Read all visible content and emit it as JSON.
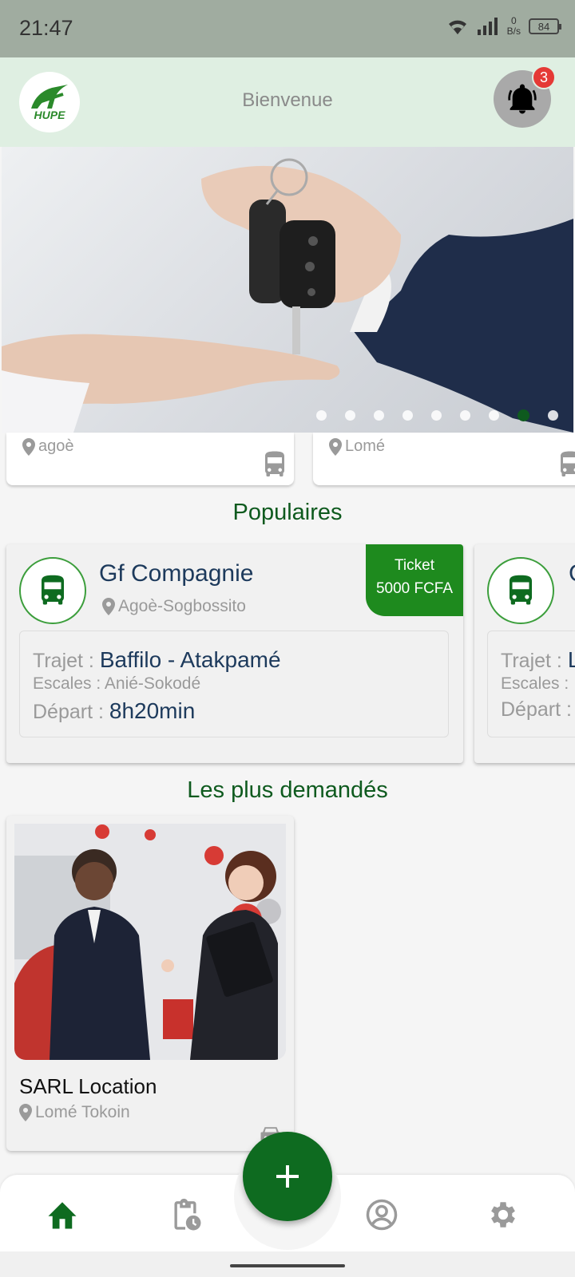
{
  "status_bar": {
    "time": "21:47",
    "net_speed_value": "0",
    "net_speed_unit": "B/s",
    "battery": "84"
  },
  "header": {
    "logo_text": "HUPE",
    "title": "Bienvenue",
    "notification_count": "3"
  },
  "banner": {
    "slide_count": 9,
    "active_slide_index": 7
  },
  "places": [
    {
      "location": "agoè"
    },
    {
      "location": "Lomé"
    }
  ],
  "populaires": {
    "title": "Populaires",
    "cards": [
      {
        "company": "Gf Compagnie",
        "address": "Agoè-Sogbossito",
        "ticket_label": "Ticket",
        "ticket_price": "5000 FCFA",
        "trajet_label": "Trajet : ",
        "trajet_value": "Baffilo - Atakpamé",
        "escales_label": "Escales : ",
        "escales_value": "Anié-Sokodé",
        "depart_label": "Départ : ",
        "depart_value": "8h20min"
      },
      {
        "company": "C",
        "trajet_label": "Trajet : ",
        "trajet_value": "L",
        "escales_label": "Escales : ",
        "depart_label": "Départ : "
      }
    ]
  },
  "demandes": {
    "title": "Les plus demandés",
    "items": [
      {
        "name": "SARL Location",
        "location": "Lomé Tokoin"
      }
    ]
  },
  "colors": {
    "primary_green": "#0e6b20",
    "ticket_green": "#1e8a1e",
    "header_bg": "#dfefe2",
    "badge_red": "#e53935"
  },
  "icons": {
    "nav": [
      "home-icon",
      "clipboard-clock-icon",
      "account-circle-icon",
      "gear-icon"
    ],
    "fab": "plus-icon"
  }
}
